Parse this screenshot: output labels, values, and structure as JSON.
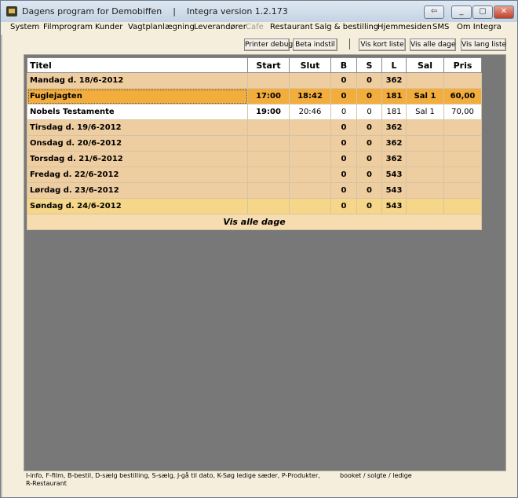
{
  "window": {
    "title": "Dagens program for Demobiffen",
    "version": "Integra version 1.2.173"
  },
  "menu": [
    {
      "label": "System",
      "disabled": false
    },
    {
      "label": "Filmprogram",
      "disabled": false
    },
    {
      "label": "Kunder",
      "disabled": false
    },
    {
      "label": "Vagtplanlægning",
      "disabled": false
    },
    {
      "label": "Leverandører",
      "disabled": false
    },
    {
      "label": "Cafe",
      "disabled": true
    },
    {
      "label": "Restaurant",
      "disabled": false
    },
    {
      "label": "Salg & bestilling",
      "disabled": false
    },
    {
      "label": "Hjemmesiden",
      "disabled": false
    },
    {
      "label": "SMS",
      "disabled": false
    },
    {
      "label": "Om Integra",
      "disabled": false
    }
  ],
  "toolbar": {
    "printer_debug": "Printer debug",
    "beta_indstil": "Beta indstil",
    "vis_kort_liste": "Vis kort liste",
    "vis_alle_dage": "Vis alle dage",
    "vis_lang_liste": "Vis lang liste"
  },
  "table": {
    "columns": [
      "Titel",
      "Start",
      "Slut",
      "B",
      "S",
      "L",
      "Sal",
      "Pris"
    ],
    "rows": [
      {
        "type": "day",
        "title": "Mandag d. 18/6-2012",
        "start": "",
        "slut": "",
        "b": "0",
        "s": "0",
        "l": "362",
        "sal": "",
        "pris": ""
      },
      {
        "type": "selected",
        "title": "Fuglejagten",
        "start": "17:00",
        "slut": "18:42",
        "b": "0",
        "s": "0",
        "l": "181",
        "sal": "Sal 1",
        "pris": "60,00"
      },
      {
        "type": "show",
        "title": "Nobels Testamente",
        "start": "19:00",
        "slut": "20:46",
        "b": "0",
        "s": "0",
        "l": "181",
        "sal": "Sal 1",
        "pris": "70,00"
      },
      {
        "type": "day",
        "title": "Tirsdag d. 19/6-2012",
        "start": "",
        "slut": "",
        "b": "0",
        "s": "0",
        "l": "362",
        "sal": "",
        "pris": ""
      },
      {
        "type": "day",
        "title": "Onsdag d. 20/6-2012",
        "start": "",
        "slut": "",
        "b": "0",
        "s": "0",
        "l": "362",
        "sal": "",
        "pris": ""
      },
      {
        "type": "day",
        "title": "Torsdag d. 21/6-2012",
        "start": "",
        "slut": "",
        "b": "0",
        "s": "0",
        "l": "362",
        "sal": "",
        "pris": ""
      },
      {
        "type": "day",
        "title": "Fredag d. 22/6-2012",
        "start": "",
        "slut": "",
        "b": "0",
        "s": "0",
        "l": "543",
        "sal": "",
        "pris": ""
      },
      {
        "type": "day",
        "title": "Lørdag d. 23/6-2012",
        "start": "",
        "slut": "",
        "b": "0",
        "s": "0",
        "l": "543",
        "sal": "",
        "pris": ""
      },
      {
        "type": "day-alt",
        "title": "Søndag d. 24/6-2012",
        "start": "",
        "slut": "",
        "b": "0",
        "s": "0",
        "l": "543",
        "sal": "",
        "pris": ""
      }
    ],
    "footer": "Vis alle dage"
  },
  "status": {
    "hotkeys": "I-info, F-film, B-bestil, D-sælg bestilling, S-sælg, J-gå til dato, K-Søg ledige sæder, P-Produkter, R-Restaurant",
    "legend": "booket / solgte / ledige"
  },
  "colors": {
    "day_row": "#eecda0",
    "selected_row": "#f2ad3c",
    "panel_bg": "#787878",
    "window_bg": "#f6eedd"
  }
}
